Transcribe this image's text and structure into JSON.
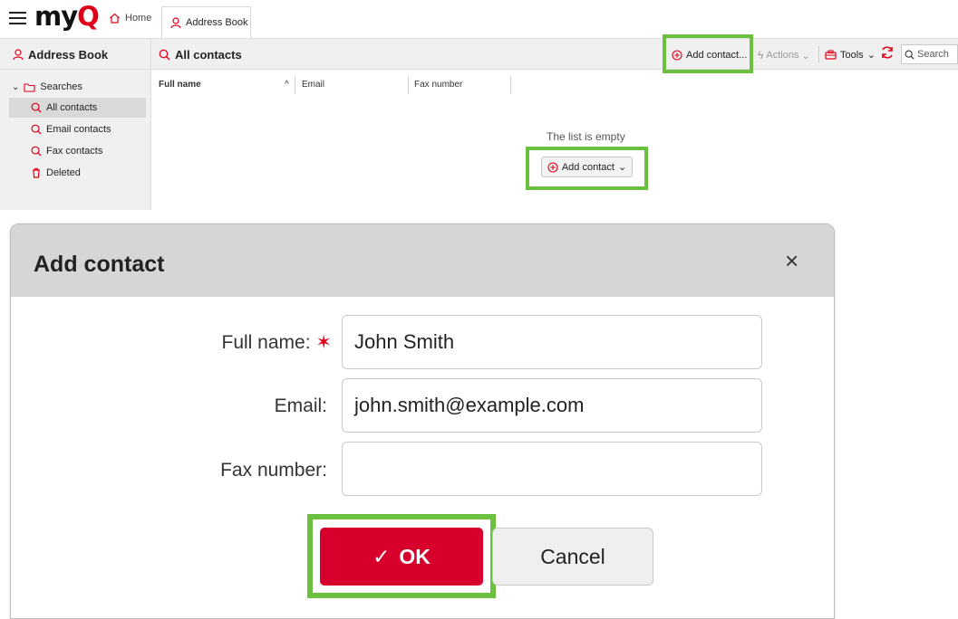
{
  "topbar": {
    "logo_text": "my",
    "logo_accent": "Q",
    "home_tab": "Home",
    "addressbook_tab": "Address Book"
  },
  "toolbar": {
    "sidebar_title": "Address Book",
    "view_title": "All contacts",
    "add_contact": "Add contact...",
    "actions": "Actions",
    "tools": "Tools",
    "search_placeholder": "Search"
  },
  "sidebar": {
    "group": "Searches",
    "items": [
      {
        "label": "All contacts",
        "icon": "search-icon"
      },
      {
        "label": "Email contacts",
        "icon": "search-icon"
      },
      {
        "label": "Fax contacts",
        "icon": "search-icon"
      },
      {
        "label": "Deleted",
        "icon": "trash-icon"
      }
    ]
  },
  "table": {
    "columns": [
      "Full name",
      "Email",
      "Fax number"
    ],
    "empty_text": "The list is empty",
    "empty_button": "Add contact"
  },
  "dialog": {
    "title": "Add contact",
    "close": "×",
    "fields": [
      {
        "label": "Full name:",
        "value": "John Smith",
        "required": true
      },
      {
        "label": "Email:",
        "value": "john.smith@example.com",
        "required": false
      },
      {
        "label": "Fax number:",
        "value": "",
        "required": false
      }
    ],
    "ok_label": "OK",
    "cancel_label": "Cancel"
  },
  "colors": {
    "accent_red": "#d7002c",
    "highlight_green": "#6bc03f"
  }
}
